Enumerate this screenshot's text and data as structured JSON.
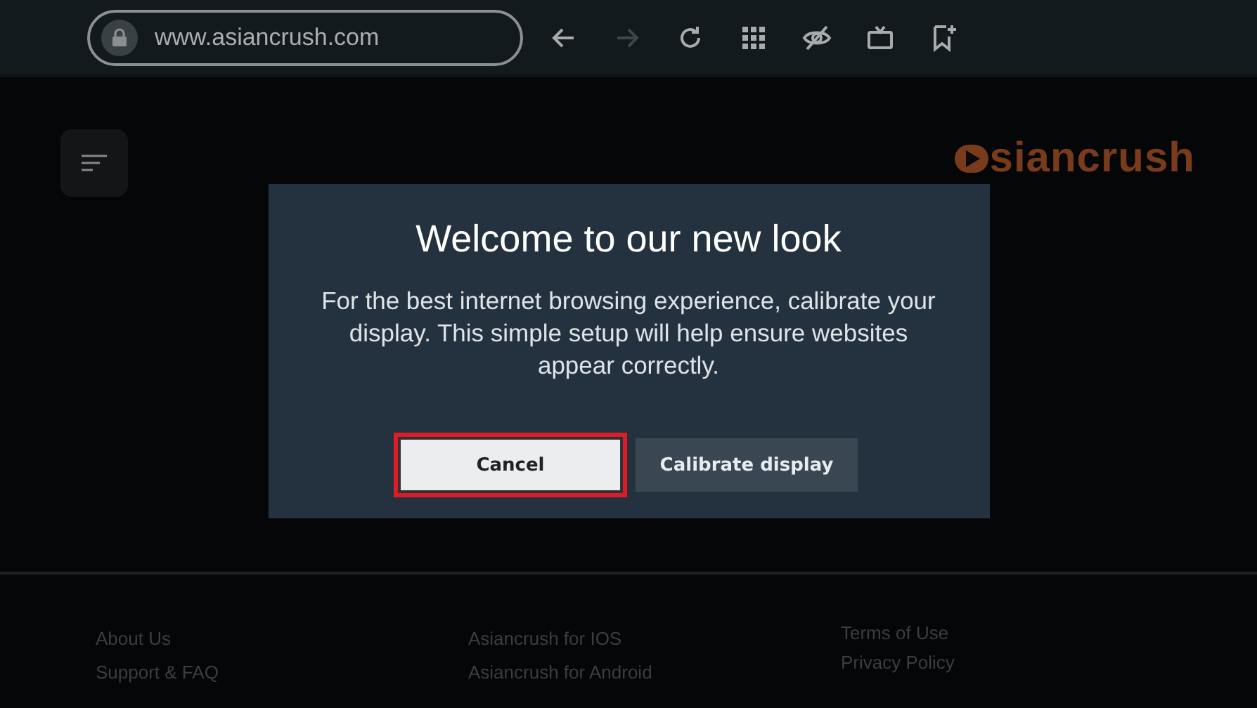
{
  "browser": {
    "address": "www.asiancrush.com",
    "toolbar": [
      {
        "kind": "back",
        "disabled": false
      },
      {
        "kind": "forward",
        "disabled": true
      },
      {
        "kind": "reload",
        "disabled": false
      },
      {
        "kind": "apps",
        "disabled": false
      },
      {
        "kind": "hide",
        "disabled": false
      },
      {
        "kind": "tv",
        "disabled": false
      },
      {
        "kind": "bookmark",
        "disabled": false
      }
    ]
  },
  "page": {
    "logo": "siancrush",
    "footer_columns": [
      [
        "About Us",
        "Support & FAQ"
      ],
      [
        "Asiancrush for IOS",
        "Asiancrush for Android"
      ],
      [
        "Terms of Use",
        "Privacy Policy"
      ]
    ]
  },
  "dialog": {
    "title": "Welcome to our new look",
    "message": "For the best internet browsing experience, calibrate your display. This simple setup will help ensure websites appear correctly.",
    "buttons": [
      {
        "label": "Cancel",
        "selected": true,
        "highlighted": true
      },
      {
        "label": "Calibrate display",
        "selected": false,
        "highlighted": false
      }
    ]
  }
}
